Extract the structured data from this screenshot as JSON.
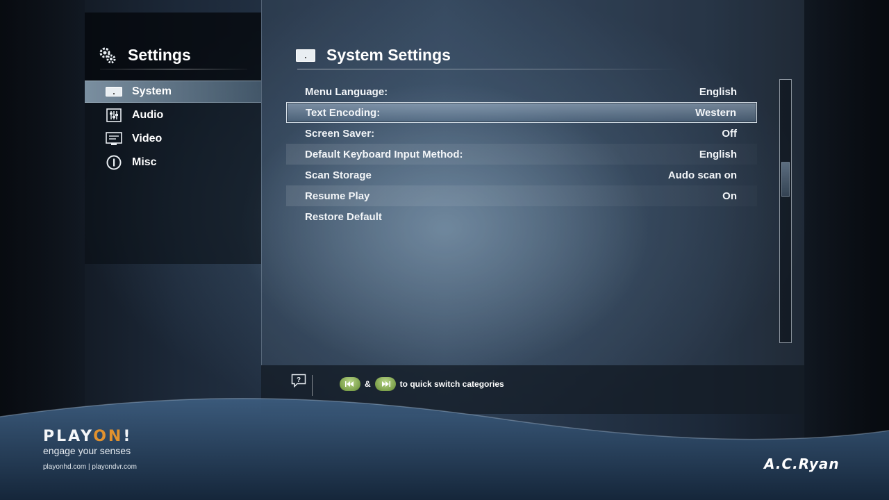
{
  "sidebar": {
    "title": "Settings",
    "items": [
      {
        "label": "System",
        "icon": "system-icon",
        "selected": true
      },
      {
        "label": "Audio",
        "icon": "audio-mixer-icon",
        "selected": false
      },
      {
        "label": "Video",
        "icon": "monitor-icon",
        "selected": false
      },
      {
        "label": "Misc",
        "icon": "info-icon",
        "selected": false
      }
    ]
  },
  "main": {
    "title": "System Settings",
    "rows": [
      {
        "label": "Menu Language:",
        "value": "English"
      },
      {
        "label": "Text Encoding:",
        "value": "Western"
      },
      {
        "label": "Screen Saver:",
        "value": "Off"
      },
      {
        "label": "Default Keyboard Input Method:",
        "value": "English"
      },
      {
        "label": "Scan Storage",
        "value": "Audo scan on"
      },
      {
        "label": "Resume Play",
        "value": "On"
      },
      {
        "label": "Restore Default",
        "value": ""
      }
    ],
    "focused_index": 1
  },
  "hint": {
    "amp": "&",
    "text": "to quick switch categories"
  },
  "branding": {
    "logo_play": "PLAY",
    "logo_on": "ON",
    "logo_bang": "!",
    "tagline": "engage your senses",
    "sites": "playonhd.com | playondvr.com",
    "maker": "A.C.Ryan"
  },
  "colors": {
    "accent_orange": "#e2922e",
    "pill_green": "#8fb35a"
  }
}
